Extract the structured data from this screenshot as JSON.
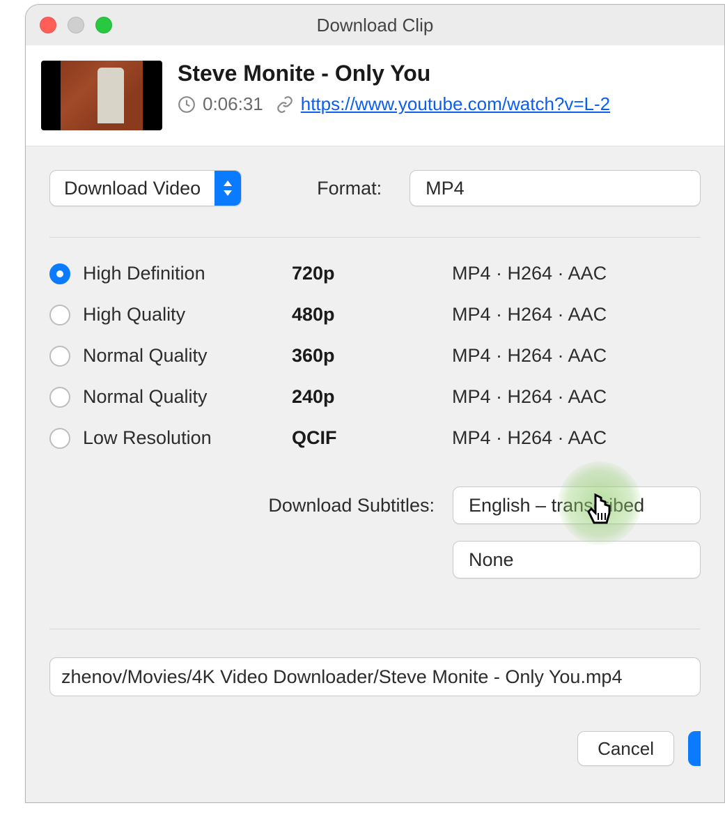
{
  "window": {
    "title": "Download Clip"
  },
  "video": {
    "title": "Steve Monite - Only You",
    "duration": "0:06:31",
    "url": "https://www.youtube.com/watch?v=L-2"
  },
  "action_select": {
    "label": "Download Video"
  },
  "format": {
    "label": "Format:",
    "value": "MP4"
  },
  "qualities": [
    {
      "label": "High Definition",
      "res": "720p",
      "codec": "MP4 · H264 · AAC",
      "selected": true
    },
    {
      "label": "High Quality",
      "res": "480p",
      "codec": "MP4 · H264 · AAC",
      "selected": false
    },
    {
      "label": "Normal Quality",
      "res": "360p",
      "codec": "MP4 · H264 · AAC",
      "selected": false
    },
    {
      "label": "Normal Quality",
      "res": "240p",
      "codec": "MP4 · H264 · AAC",
      "selected": false
    },
    {
      "label": "Low Resolution",
      "res": "QCIF",
      "codec": "MP4 · H264 · AAC",
      "selected": false
    }
  ],
  "subtitles": {
    "label": "Download Subtitles:",
    "selected": "English – transcribed",
    "secondary": "None"
  },
  "save_path": "zhenov/Movies/4K Video Downloader/Steve Monite - Only You.mp4",
  "buttons": {
    "cancel": "Cancel"
  }
}
